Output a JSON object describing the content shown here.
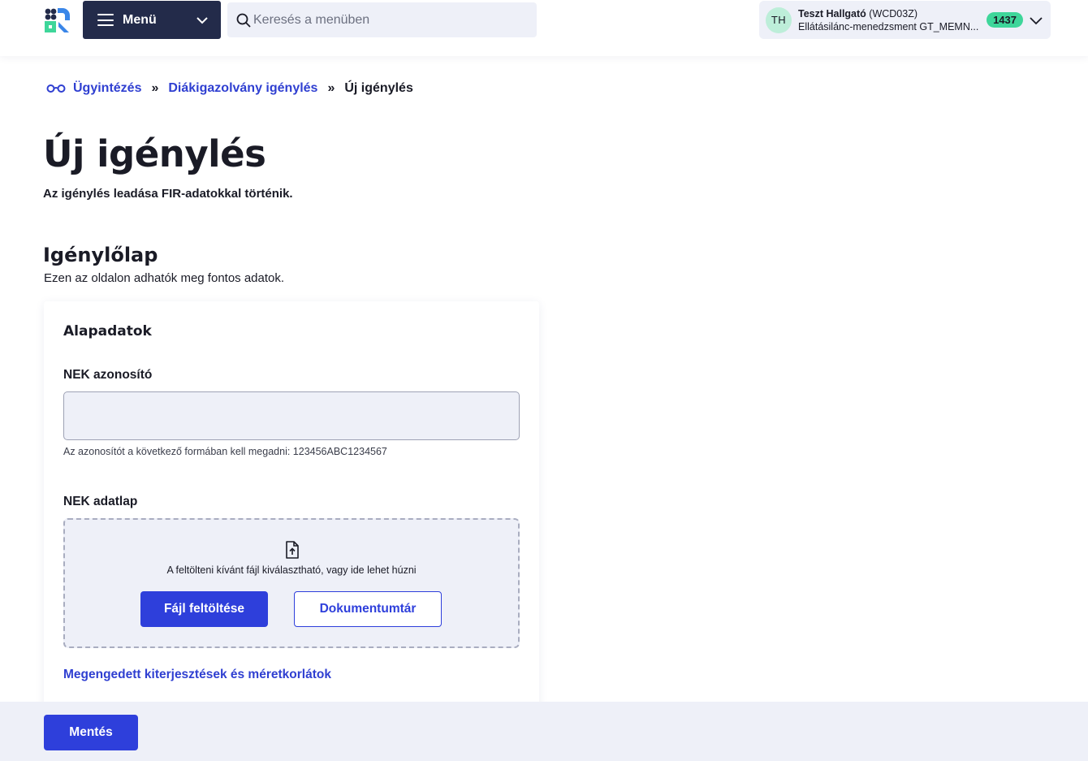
{
  "header": {
    "menu_label": "Menü",
    "search_placeholder": "Keresés a menüben",
    "user": {
      "initials": "TH",
      "name": "Teszt Hallgató",
      "code": "(WCD03Z)",
      "role": "Ellátásilánc-menedzsment GT_MEMN...",
      "badge": "1437"
    }
  },
  "breadcrumb": {
    "items": [
      "Ügyintézés",
      "Diákigazolvány igénylés"
    ],
    "separator": "»",
    "current": "Új igénylés"
  },
  "page": {
    "title": "Új igénylés",
    "subtitle": "Az igénylés leadása FIR-adatokkal történik."
  },
  "form": {
    "section_title": "Igénylőlap",
    "section_desc": "Ezen az oldalon adhatók meg fontos adatok.",
    "card_title": "Alapadatok",
    "nek_id": {
      "label": "NEK azonosító",
      "value": "",
      "hint": "Az azonosítót a következő formában kell megadni: 123456ABC1234567"
    },
    "nek_sheet": {
      "label": "NEK adatlap",
      "dropzone_text": "A feltölteni kívánt fájl kiválasztható, vagy ide lehet húzni",
      "upload_button": "Fájl feltöltése",
      "library_button": "Dokumentumtár"
    },
    "extensions_link": "Megengedett kiterjesztések és méretkorlátok"
  },
  "footer": {
    "save_button": "Mentés"
  },
  "colors": {
    "primary": "#2e3fdb",
    "menu_bg": "#232b4a",
    "surface": "#eef0f8",
    "badge": "#3ed69a",
    "avatar": "#bdeed9"
  },
  "icons": [
    "app-logo-icon",
    "hamburger-icon",
    "chevron-down-icon",
    "search-icon",
    "glasses-icon",
    "file-upload-icon"
  ]
}
